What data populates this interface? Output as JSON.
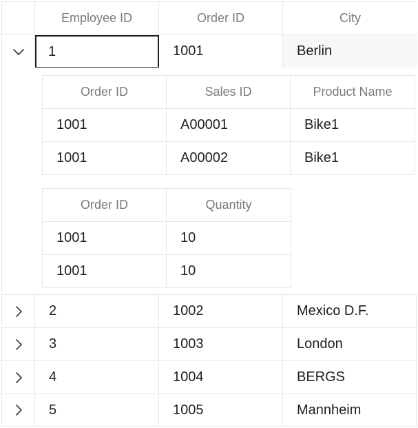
{
  "main": {
    "columns": [
      "Employee ID",
      "Order ID",
      "City"
    ],
    "rows": [
      {
        "expanded": true,
        "employee_id": "1",
        "order_id": "1001",
        "city": "Berlin"
      },
      {
        "expanded": false,
        "employee_id": "2",
        "order_id": "1002",
        "city": "Mexico D.F."
      },
      {
        "expanded": false,
        "employee_id": "3",
        "order_id": "1003",
        "city": "London"
      },
      {
        "expanded": false,
        "employee_id": "4",
        "order_id": "1004",
        "city": "BERGS"
      },
      {
        "expanded": false,
        "employee_id": "5",
        "order_id": "1005",
        "city": "Mannheim"
      }
    ]
  },
  "details": {
    "sales": {
      "columns": [
        "Order ID",
        "Sales ID",
        "Product Name"
      ],
      "rows": [
        {
          "order_id": "1001",
          "sales_id": "A00001",
          "product_name": "Bike1"
        },
        {
          "order_id": "1001",
          "sales_id": "A00002",
          "product_name": "Bike1"
        }
      ]
    },
    "quantity": {
      "columns": [
        "Order ID",
        "Quantity"
      ],
      "rows": [
        {
          "order_id": "1001",
          "quantity": "10"
        },
        {
          "order_id": "1001",
          "quantity": "10"
        }
      ]
    }
  },
  "icons": {
    "expanded": "chevron-down-icon",
    "collapsed": "chevron-right-icon"
  },
  "colors": {
    "border": "#e6e6e6",
    "header_text": "#7b7b7b",
    "cell_text": "#1f1f1f",
    "selected_border": "#1f1f1f",
    "row_highlight": "#f7f7f7"
  }
}
